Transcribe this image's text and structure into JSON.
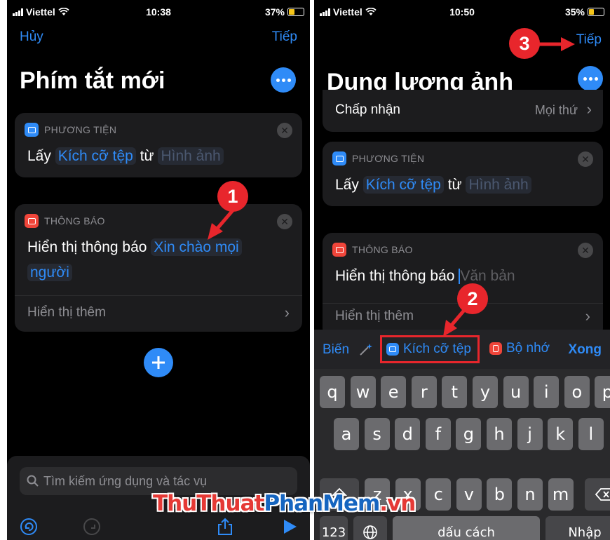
{
  "left": {
    "status": {
      "carrier": "Viettel",
      "time": "10:38",
      "battery": "37%",
      "battery_level": 0.37
    },
    "nav": {
      "cancel": "Hủy",
      "next": "Tiếp"
    },
    "title": "Phím tắt mới",
    "media_card": {
      "header": "PHƯƠNG TIỆN",
      "verb": "Lấy",
      "param": "Kích cỡ tệp",
      "from": "từ",
      "source": "Hình ảnh"
    },
    "notify_card": {
      "header": "THÔNG BÁO",
      "label": "Hiển thị thông báo",
      "text_line1": "Xin chào mọi",
      "text_line2": "người",
      "show_more": "Hiển thị thêm"
    },
    "search_placeholder": "Tìm kiếm ứng dụng và tác vụ",
    "annotation": "1"
  },
  "right": {
    "status": {
      "carrier": "Viettel",
      "time": "10:50",
      "battery": "35%",
      "battery_level": 0.35
    },
    "nav": {
      "next": "Tiếp"
    },
    "title": "Dung lượng ảnh",
    "accept_row": {
      "label": "Chấp nhận",
      "value": "Mọi thứ"
    },
    "media_card": {
      "header": "PHƯƠNG TIỆN",
      "verb": "Lấy",
      "param": "Kích cỡ tệp",
      "from": "từ",
      "source": "Hình ảnh"
    },
    "notify_card": {
      "header": "THÔNG BÁO",
      "label": "Hiển thị thông báo",
      "placeholder": "Văn bản",
      "show_more": "Hiển thị thêm"
    },
    "suggestions": {
      "variables": "Biến",
      "file_size": "Kích cỡ tệp",
      "clipboard": "Bộ nhớ",
      "done": "Xong"
    },
    "keyboard": {
      "row1": [
        "q",
        "w",
        "e",
        "r",
        "t",
        "y",
        "u",
        "i",
        "o",
        "p"
      ],
      "row2": [
        "a",
        "s",
        "d",
        "f",
        "g",
        "h",
        "j",
        "k",
        "l"
      ],
      "row3": [
        "z",
        "x",
        "c",
        "v",
        "b",
        "n",
        "m"
      ],
      "numbers": "123",
      "space": "dấu cách",
      "return": "Nhập"
    },
    "annotation_2": "2",
    "annotation_3": "3"
  },
  "watermark": {
    "part1": "ThuThuat",
    "part2": "PhanMem",
    "part3": ".vn"
  },
  "colors": {
    "accent": "#2f8bf7",
    "annotation": "#e8262c",
    "highlight_box": "#e8262c"
  }
}
